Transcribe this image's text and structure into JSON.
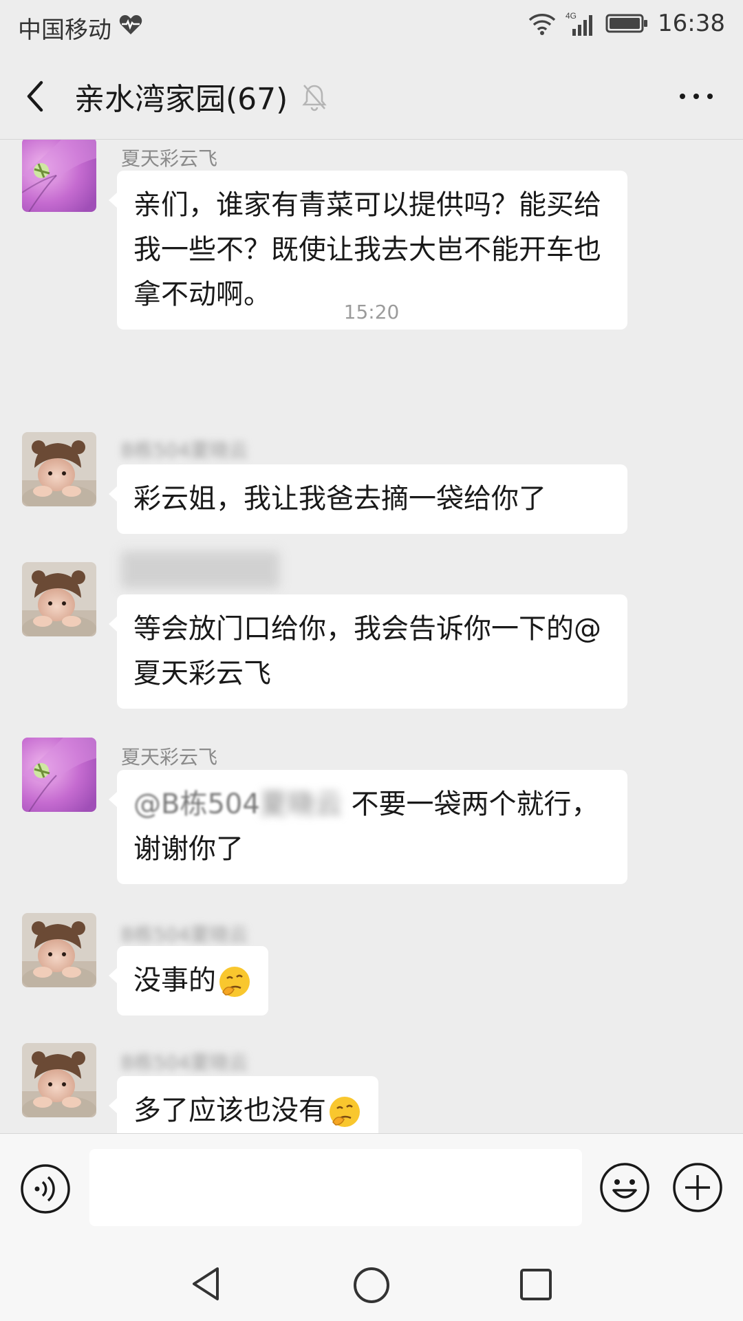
{
  "status_bar": {
    "carrier": "中国移动",
    "network": "4G",
    "time": "16:38"
  },
  "header": {
    "title": "亲水湾家园(67)"
  },
  "chat": {
    "messages": [
      {
        "sender": "夏天彩云飞",
        "avatar": "purple-flower",
        "text": "亲们，谁家有青菜可以提供吗？能买给我一些不？既使让我去大岜不能开车也拿不动啊。"
      },
      {
        "timestamp": "15:20"
      },
      {
        "sender": "B栋504夏晓云",
        "sender_redacted": true,
        "avatar": "baby-bear-hat",
        "text": "彩云姐，我让我爸去摘一袋给你了"
      },
      {
        "sender": "",
        "sender_redacted": true,
        "avatar": "baby-bear-hat",
        "text": "等会放门口给你，我会告诉你一下的@夏天彩云飞"
      },
      {
        "sender": "夏天彩云飞",
        "avatar": "purple-flower",
        "text_prefix": "@B栋504",
        "text_redacted": "夏晓云",
        "text": " 不要一袋两个就行，谢谢你了"
      },
      {
        "sender": "B栋504夏晓云",
        "sender_redacted": true,
        "avatar": "baby-bear-hat",
        "text": "没事的",
        "emoji": "thinking-face"
      },
      {
        "sender": "B栋504夏晓云",
        "sender_redacted": true,
        "avatar": "baby-bear-hat",
        "text": "多了应该也没有",
        "emoji": "thinking-face"
      }
    ]
  },
  "input": {
    "placeholder": ""
  },
  "colors": {
    "background": "#ededed",
    "bubble": "#ffffff",
    "bar": "#f7f7f7"
  }
}
